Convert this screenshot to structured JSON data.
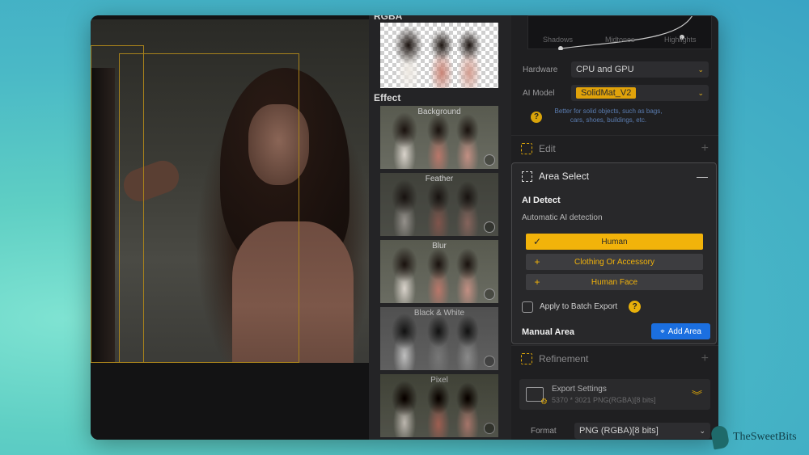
{
  "thumbnails": {
    "rgba_label": "RGBA",
    "effect_label": "Effect",
    "items": [
      {
        "label": "Background"
      },
      {
        "label": "Feather"
      },
      {
        "label": "Blur"
      },
      {
        "label": "Black & White"
      },
      {
        "label": "Pixel"
      }
    ]
  },
  "curve": {
    "labels": [
      "Shadows",
      "Midtones",
      "Highlights"
    ]
  },
  "settings": {
    "hardware_label": "Hardware",
    "hardware_value": "CPU and GPU",
    "ai_model_label": "AI Model",
    "ai_model_value": "SolidMat_V2",
    "hint": "Better for solid objects, such as bags, cars, shoes, buildings, etc."
  },
  "sections": {
    "edit": "Edit",
    "refinement": "Refinement"
  },
  "area_select": {
    "title": "Area Select",
    "ai_detect": "AI Detect",
    "ai_sub": "Automatic AI detection",
    "options": [
      {
        "label": "Human",
        "selected": true
      },
      {
        "label": "Clothing Or Accessory",
        "selected": false
      },
      {
        "label": "Human Face",
        "selected": false
      }
    ],
    "batch_label": "Apply to Batch Export",
    "manual_area": "Manual Area",
    "add_area": "Add Area"
  },
  "export": {
    "title": "Export Settings",
    "sub": "5370 * 3021 PNG(RGBA)[8 bits]",
    "format_label": "Format",
    "format_value": "PNG (RGBA)[8 bits]"
  },
  "brand": "TheSweetBits",
  "colors": {
    "accent": "#f2b30a",
    "primary_button": "#1b6fe0"
  }
}
